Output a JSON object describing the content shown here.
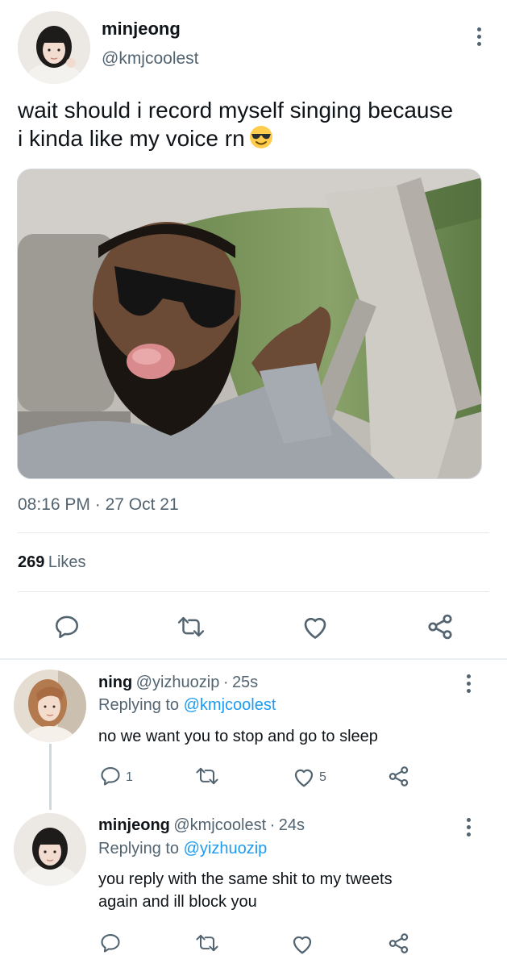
{
  "main_tweet": {
    "name": "minjeong",
    "handle": "@kmjcoolest",
    "text_line1": "wait should i record myself singing because",
    "text_line2": "i kinda like my voice rn",
    "emoji": "sunglasses-emoji",
    "image": "photo of a bearded man in sunglasses sticking his tongue out in a car",
    "time": "08:16 PM",
    "date_sep": "·",
    "date": "27 Oct 21",
    "likes_count": "269",
    "likes_label": "Likes",
    "actions": [
      "reply-icon",
      "retweet-icon",
      "like-icon",
      "share-icon"
    ]
  },
  "replies": [
    {
      "name": "ning",
      "handle": "@yizhuozip",
      "sep": "·",
      "time": "25s",
      "replying_prefix": "Replying to",
      "replying_to": "@kmjcoolest",
      "text": "no we want you to stop and go to sleep",
      "reply_count": "1",
      "retweet_count": "",
      "like_count": "5"
    },
    {
      "name": "minjeong",
      "handle": "@kmjcoolest",
      "sep": "·",
      "time": "24s",
      "replying_prefix": "Replying to",
      "replying_to": "@yizhuozip",
      "text_line1": "you reply with the same shit to my tweets",
      "text_line2": "again and ill block you",
      "reply_count": "",
      "retweet_count": "",
      "like_count": ""
    }
  ],
  "colors": {
    "text": "#0f1419",
    "secondary": "#536471",
    "link": "#1d9bf0",
    "divider": "#e6e9ec"
  }
}
